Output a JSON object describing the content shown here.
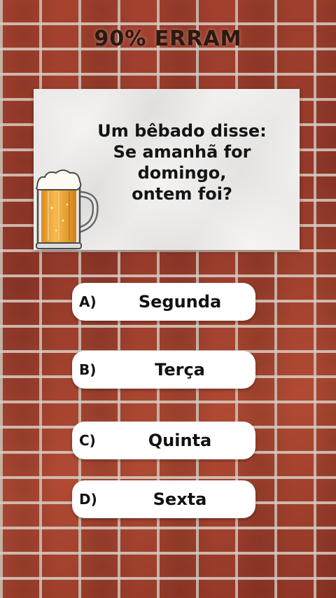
{
  "headline": "90% ERRAM",
  "question": {
    "lines": [
      "Um bêbado disse:",
      "Se amanhã for",
      "domingo,",
      "ontem foi?"
    ]
  },
  "image": {
    "icon": "beer-mug-icon"
  },
  "answers": [
    {
      "letter": "A)",
      "text": "Segunda"
    },
    {
      "letter": "B)",
      "text": "Terça"
    },
    {
      "letter": "C)",
      "text": "Quinta"
    },
    {
      "letter": "D)",
      "text": "Sexta"
    }
  ],
  "colors": {
    "brick": "#a8432f",
    "mortar": "#d7cdc3",
    "paper": "#f4f3f1",
    "answer_bg": "#ffffff",
    "beer": "#f2a12b"
  }
}
